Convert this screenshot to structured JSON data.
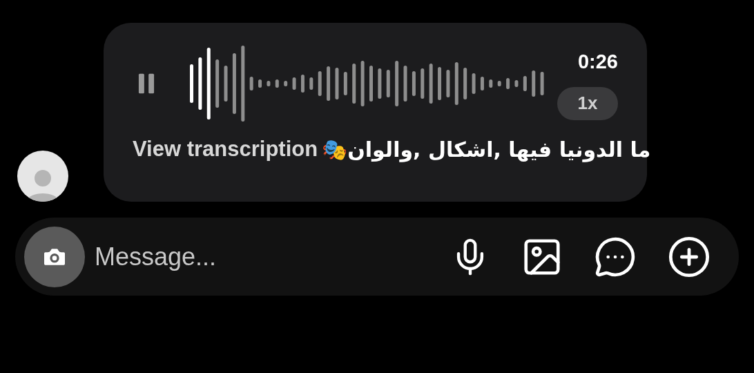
{
  "voice_message": {
    "playing": true,
    "duration": "0:26",
    "speed": "1x",
    "transcription_link": "View transcription"
  },
  "caption": "ما الدونيا فيها ,اشكال ,والوان🎭",
  "composer": {
    "placeholder": "Message..."
  }
}
